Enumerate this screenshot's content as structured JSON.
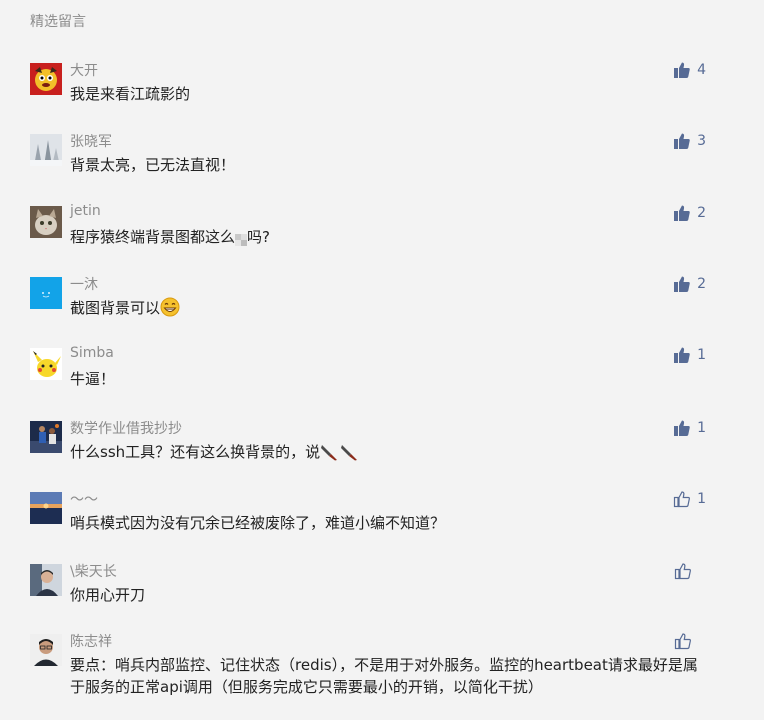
{
  "section_title": "精选留言",
  "comments": [
    {
      "nickname": "大开",
      "text": "我是来看江疏影的",
      "likes": "4",
      "liked": true,
      "avatar": "cartoon-avatar"
    },
    {
      "nickname": "张晓军",
      "text": "背景太亮，已无法直视！",
      "likes": "3",
      "liked": true,
      "avatar": "snow-tree-avatar"
    },
    {
      "nickname": "jetin",
      "text_before": "程序猿终端背景图都这么",
      "text_after": "吗?",
      "likes": "2",
      "liked": true,
      "avatar": "cat-avatar"
    },
    {
      "nickname": "一沐",
      "text": "截图背景可以",
      "likes": "2",
      "liked": true,
      "avatar": "blue-avatar"
    },
    {
      "nickname": "Simba",
      "text": "牛逼！",
      "likes": "1",
      "liked": true,
      "avatar": "pikachu-avatar"
    },
    {
      "nickname": "数学作业借我抄抄",
      "text": "什么ssh工具？还有这么换背景的，说",
      "likes": "1",
      "liked": true,
      "avatar": "basketball-avatar"
    },
    {
      "nickname": "～～",
      "text": "哨兵模式因为没有冗余已经被废除了，难道小编不知道？",
      "likes": "1",
      "liked": false,
      "avatar": "sunset-avatar"
    },
    {
      "nickname": "\\柴天长",
      "text": "你用心开刀",
      "likes": "",
      "liked": false,
      "avatar": "man-avatar"
    },
    {
      "nickname": "陈志祥",
      "text": "要点：哨兵内部监控、记住状态（redis），不是用于对外服务。监控的heartbeat请求最好是属于服务的正常api调用（但服务完成它只需要最小的开销，以简化干扰）",
      "likes": "",
      "liked": false,
      "avatar": "man-glasses-avatar"
    }
  ],
  "colors": {
    "like_blue": "#576b95",
    "nickname_gray": "#8c8c8c",
    "background": "#f3f3f3"
  }
}
